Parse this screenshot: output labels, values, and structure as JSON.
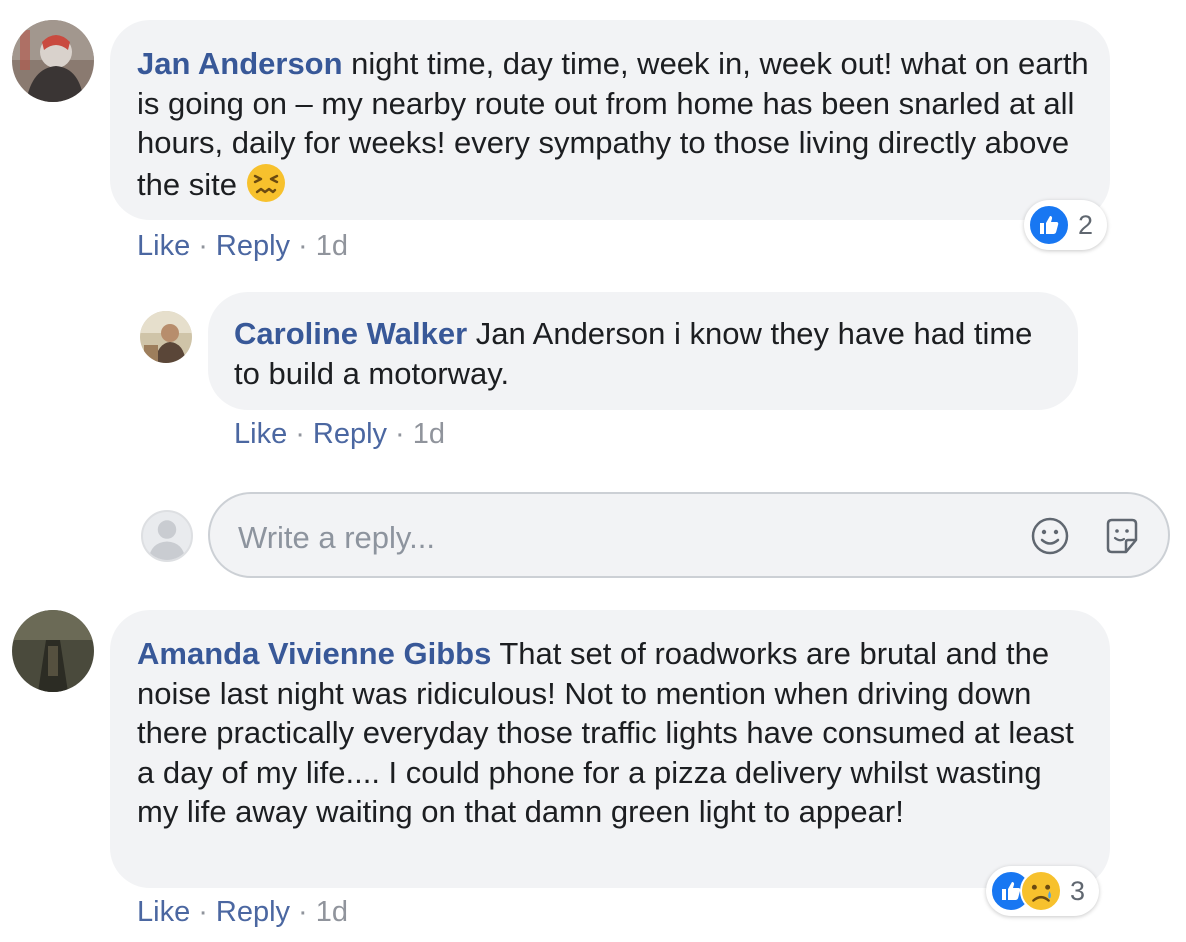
{
  "comments": [
    {
      "author": "Jan Anderson",
      "text": " night time, day time, week in, week out! what on earth is going on – my nearby route out from home has been snarled at all hours, daily for weeks! every sympathy to those living directly above the site ",
      "emoji": "confounded-face-icon",
      "reactions": {
        "types": [
          "like"
        ],
        "count": "2"
      },
      "actions": {
        "like": "Like",
        "reply": "Reply",
        "time": "1d"
      },
      "reply": {
        "author": "Caroline Walker",
        "text": " Jan Anderson i know they have had time to build a motorway.",
        "actions": {
          "like": "Like",
          "reply": "Reply",
          "time": "1d"
        }
      }
    },
    {
      "author": "Amanda Vivienne Gibbs",
      "text": " That set of roadworks are brutal and the noise last night was ridiculous! Not to mention when driving down there practically everyday those traffic lights have consumed at least a day of my life.... I could phone for a pizza delivery whilst wasting my life away waiting on that damn green light to appear!",
      "reactions": {
        "types": [
          "like",
          "sad"
        ],
        "count": "3"
      },
      "actions": {
        "like": "Like",
        "reply": "Reply",
        "time": "1d"
      }
    }
  ],
  "reply_box": {
    "placeholder": "Write a reply...",
    "icons": [
      "emoji-icon",
      "sticker-icon"
    ]
  },
  "separator": "·",
  "colors": {
    "author": "#385898",
    "link": "#4b67a1",
    "meta": "#90949c",
    "bubble": "#f2f3f5",
    "like_blue": "#1877f2"
  }
}
